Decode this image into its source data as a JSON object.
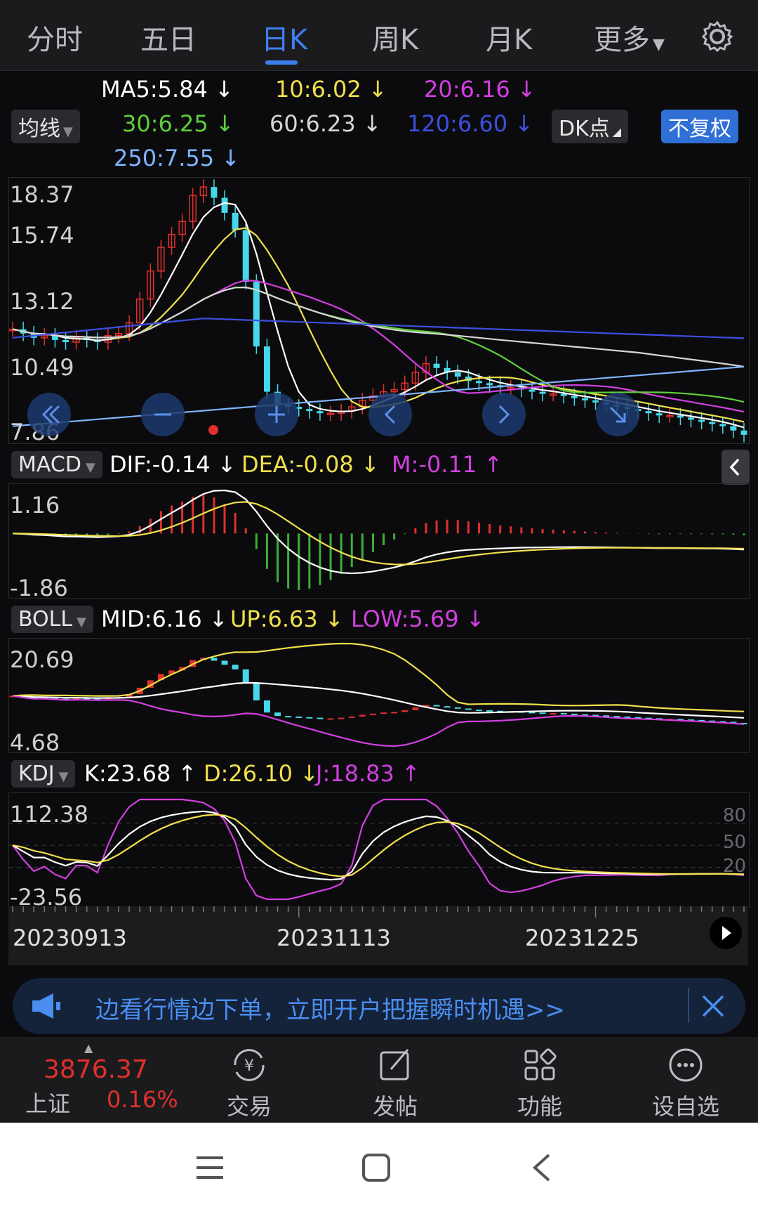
{
  "tabs": [
    "分时",
    "五日",
    "日K",
    "周K",
    "月K",
    "更多"
  ],
  "tabs_active_index": 2,
  "ma": {
    "ma5": "MA5:5.84",
    "ma10": "10:6.02",
    "ma20": "20:6.16",
    "ma30": "30:6.25",
    "ma60": "60:6.23",
    "ma120": "120:6.60",
    "ma250": "250:7.55",
    "arrow": "↓"
  },
  "buttons": {
    "avg_line": "均线",
    "dk": "DK点",
    "no_adjust": "不复权"
  },
  "main_axis": [
    "18.37",
    "15.74",
    "13.12",
    "10.49",
    "7.86"
  ],
  "macd": {
    "name": "MACD",
    "dif": "DIF:-0.14",
    "dea": "DEA:-0.08",
    "m": "M:-0.11",
    "axis_top": "1.16",
    "axis_bottom": "-1.86"
  },
  "boll": {
    "name": "BOLL",
    "mid": "MID:6.16",
    "up": "UP:6.63",
    "low": "LOW:5.69",
    "axis_top": "20.69",
    "axis_bottom": "4.68"
  },
  "kdj": {
    "name": "KDJ",
    "k": "K:23.68",
    "d": "D:26.10",
    "j": "J:18.83",
    "axis_top": "112.38",
    "axis_bottom": "-23.56",
    "right_ticks": [
      "80",
      "50",
      "20"
    ]
  },
  "dates": [
    "20230913",
    "20231113",
    "20231225"
  ],
  "banner_text": "边看行情边下单，立即开户把握瞬时机遇>>",
  "index": {
    "value": "3876.37",
    "name": "上证",
    "change": "0.16%"
  },
  "bottom_nav": [
    "交易",
    "发帖",
    "功能",
    "设自选"
  ],
  "colors": {
    "ma5": "#ffffff",
    "ma10": "#f0e04c",
    "ma20": "#d23fe0",
    "ma30": "#5fcf3a",
    "ma60": "#d6d6d6",
    "ma120": "#3d4fe0",
    "ma250": "#7fb3ff",
    "up": "#e0302c",
    "down": "#46d8e8",
    "accent": "#3d7ff0"
  },
  "chart_data": {
    "type": "candlestick",
    "note_series": "approximate daily closes",
    "closes": [
      11.8,
      11.6,
      11.4,
      11.5,
      11.3,
      11.2,
      11.4,
      11.3,
      11.2,
      11.5,
      11.6,
      12.1,
      13.2,
      14.5,
      15.6,
      16.2,
      16.8,
      18.0,
      18.4,
      17.9,
      17.2,
      16.4,
      14.0,
      11.0,
      8.9,
      8.3,
      8.2,
      8.1,
      8.0,
      7.9,
      7.9,
      8.0,
      8.2,
      8.5,
      8.7,
      8.9,
      9.0,
      9.3,
      9.8,
      10.2,
      10.0,
      9.8,
      9.6,
      9.4,
      9.3,
      9.2,
      9.1,
      9.1,
      9.0,
      8.9,
      8.8,
      8.8,
      8.7,
      8.6,
      8.5,
      8.4,
      8.3,
      8.2,
      8.1,
      8.0,
      7.9,
      7.8,
      7.8,
      7.7,
      7.6,
      7.5,
      7.4,
      7.3,
      7.1,
      6.9
    ],
    "ylim": [
      7.86,
      18.37
    ]
  }
}
